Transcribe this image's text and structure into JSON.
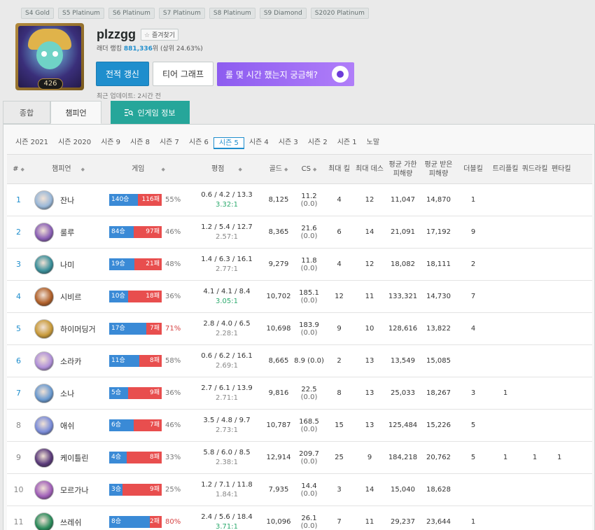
{
  "past_seasons": [
    "S4 Gold",
    "S5 Platinum",
    "S6 Platinum",
    "S7 Platinum",
    "S8 Platinum",
    "S9 Diamond",
    "S2020 Platinum"
  ],
  "profile": {
    "level": "426",
    "name": "plzzgg",
    "favorite_label": "즐겨찾기",
    "ladder_prefix": "래더 랭킹",
    "ladder_rank": "881,336",
    "ladder_suffix": "위 (상위 24.63%)",
    "refresh_label": "전적 갱신",
    "tier_graph_label": "티어 그래프",
    "promo_label": "롤 몇 시간 했는지 궁금해?",
    "updated": "최근 업데이트: 2시간 전"
  },
  "tabs": {
    "overview": "종합",
    "champion": "챔피언",
    "ingame": "인게임 정보"
  },
  "season_nav": [
    "시즌 2021",
    "시즌 2020",
    "시즌 9",
    "시즌 8",
    "시즌 7",
    "시즌 6",
    "시즌 5",
    "시즌 4",
    "시즌 3",
    "시즌 2",
    "시즌 1",
    "노말"
  ],
  "season_active_index": 6,
  "table": {
    "headers": {
      "rank": "#",
      "champion": "챔피언",
      "games": "게임",
      "kda": "평점",
      "gold": "골드",
      "cs": "CS",
      "max_kills": "최대 킬",
      "max_deaths": "최대 데스",
      "avg_dealt": "평균 가한 피해량",
      "avg_taken": "평균 받은 피해량",
      "double": "더블킬",
      "triple": "트리플킬",
      "quadra": "쿼드라킬",
      "penta": "펜타킬"
    },
    "rows": [
      {
        "rank": "1",
        "name": "잔나",
        "wins": "140승",
        "losses": "116패",
        "win_frac": 0.547,
        "pct": "55%",
        "kda": "0.6 / 4.2 / 13.3",
        "ratio": "3.32:1",
        "gold": "8,125",
        "cs": "11.2",
        "cs_sub": "(0.0)",
        "max_k": "4",
        "max_d": "12",
        "dealt": "11,047",
        "taken": "14,870",
        "double": "1",
        "triple": "",
        "quadra": "",
        "penta": "",
        "color": "#9ab8d8"
      },
      {
        "rank": "2",
        "name": "룰루",
        "wins": "84승",
        "losses": "97패",
        "win_frac": 0.464,
        "pct": "46%",
        "kda": "1.2 / 5.4 / 12.7",
        "ratio": "2.57:1",
        "gold": "8,365",
        "cs": "21.6",
        "cs_sub": "(0.0)",
        "max_k": "6",
        "max_d": "14",
        "dealt": "21,091",
        "taken": "17,192",
        "double": "9",
        "triple": "",
        "quadra": "",
        "penta": "",
        "color": "#8a5fb5"
      },
      {
        "rank": "3",
        "name": "나미",
        "wins": "19승",
        "losses": "21패",
        "win_frac": 0.475,
        "pct": "48%",
        "kda": "1.4 / 6.3 / 16.1",
        "ratio": "2.77:1",
        "gold": "9,279",
        "cs": "11.8",
        "cs_sub": "(0.0)",
        "max_k": "4",
        "max_d": "12",
        "dealt": "18,082",
        "taken": "18,111",
        "double": "2",
        "triple": "",
        "quadra": "",
        "penta": "",
        "color": "#3a8f9a"
      },
      {
        "rank": "4",
        "name": "시비르",
        "wins": "10승",
        "losses": "18패",
        "win_frac": 0.357,
        "pct": "36%",
        "kda": "4.1 / 4.1 / 8.4",
        "ratio": "3.05:1",
        "gold": "10,702",
        "cs": "185.1",
        "cs_sub": "(0.0)",
        "max_k": "12",
        "max_d": "11",
        "dealt": "133,321",
        "taken": "14,730",
        "double": "7",
        "triple": "",
        "quadra": "",
        "penta": "",
        "color": "#b0602a"
      },
      {
        "rank": "5",
        "name": "하이머딩거",
        "wins": "17승",
        "losses": "7패",
        "win_frac": 0.708,
        "pct": "71%",
        "kda": "2.8 / 4.0 / 6.5",
        "ratio": "2.28:1",
        "gold": "10,698",
        "cs": "183.9",
        "cs_sub": "(0.0)",
        "max_k": "9",
        "max_d": "10",
        "dealt": "128,616",
        "taken": "13,822",
        "double": "4",
        "triple": "",
        "quadra": "",
        "penta": "",
        "color": "#c89a3a"
      },
      {
        "rank": "6",
        "name": "소라카",
        "wins": "11승",
        "losses": "8패",
        "win_frac": 0.579,
        "pct": "58%",
        "kda": "0.6 / 6.2 / 16.1",
        "ratio": "2.69:1",
        "gold": "8,665",
        "cs": "8.9 (0.0)",
        "cs_sub": "",
        "max_k": "2",
        "max_d": "13",
        "dealt": "13,549",
        "taken": "15,085",
        "double": "",
        "triple": "",
        "quadra": "",
        "penta": "",
        "color": "#b090d8"
      },
      {
        "rank": "7",
        "name": "소나",
        "wins": "5승",
        "losses": "9패",
        "win_frac": 0.357,
        "pct": "36%",
        "kda": "2.7 / 6.1 / 13.9",
        "ratio": "2.71:1",
        "gold": "9,816",
        "cs": "22.5",
        "cs_sub": "(0.0)",
        "max_k": "8",
        "max_d": "13",
        "dealt": "25,033",
        "taken": "18,267",
        "double": "3",
        "triple": "1",
        "quadra": "",
        "penta": "",
        "color": "#6a9ad0"
      },
      {
        "rank": "8",
        "name": "애쉬",
        "wins": "6승",
        "losses": "7패",
        "win_frac": 0.462,
        "pct": "46%",
        "kda": "3.5 / 4.8 / 9.7",
        "ratio": "2.73:1",
        "gold": "10,787",
        "cs": "168.5",
        "cs_sub": "(0.0)",
        "max_k": "15",
        "max_d": "13",
        "dealt": "125,484",
        "taken": "15,226",
        "double": "5",
        "triple": "",
        "quadra": "",
        "penta": "",
        "color": "#7a8cd8"
      },
      {
        "rank": "9",
        "name": "케이틀린",
        "wins": "4승",
        "losses": "8패",
        "win_frac": 0.333,
        "pct": "33%",
        "kda": "5.8 / 6.0 / 8.5",
        "ratio": "2.38:1",
        "gold": "12,914",
        "cs": "209.7",
        "cs_sub": "(0.0)",
        "max_k": "25",
        "max_d": "9",
        "dealt": "184,218",
        "taken": "20,762",
        "double": "5",
        "triple": "1",
        "quadra": "1",
        "penta": "1",
        "color": "#5a3a7a"
      },
      {
        "rank": "10",
        "name": "모르가나",
        "wins": "3승",
        "losses": "9패",
        "win_frac": 0.25,
        "pct": "25%",
        "kda": "1.2 / 7.1 / 11.8",
        "ratio": "1.84:1",
        "gold": "7,935",
        "cs": "14.4",
        "cs_sub": "(0.0)",
        "max_k": "3",
        "max_d": "14",
        "dealt": "15,040",
        "taken": "18,628",
        "double": "",
        "triple": "",
        "quadra": "",
        "penta": "",
        "color": "#a060b8"
      },
      {
        "rank": "11",
        "name": "쓰레쉬",
        "wins": "8승",
        "losses": "2패",
        "win_frac": 0.8,
        "pct": "80%",
        "kda": "2.4 / 5.6 / 18.4",
        "ratio": "3.71:1",
        "gold": "10,096",
        "cs": "26.1",
        "cs_sub": "(0.0)",
        "max_k": "7",
        "max_d": "11",
        "dealt": "29,237",
        "taken": "23,644",
        "double": "1",
        "triple": "",
        "quadra": "",
        "penta": "",
        "color": "#2a8a5a"
      }
    ]
  }
}
